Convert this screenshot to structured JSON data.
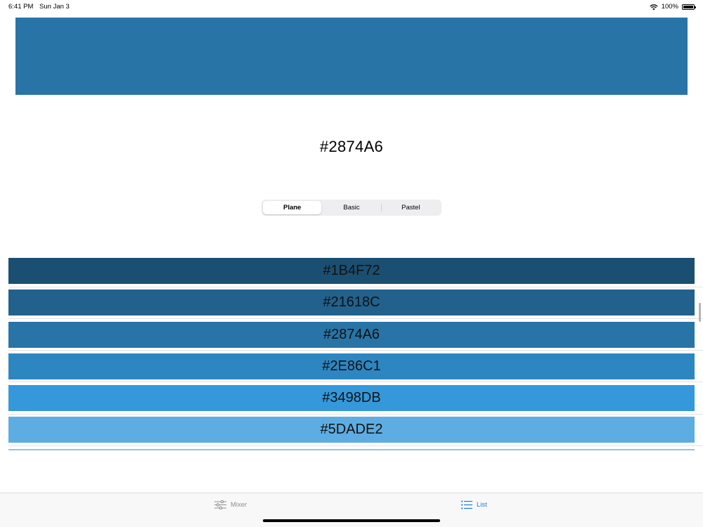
{
  "status_bar": {
    "time": "6:41 PM",
    "date": "Sun Jan 3",
    "battery": "100%",
    "icons": [
      "wifi-icon",
      "battery-icon"
    ]
  },
  "preview": {
    "color": "#2874A6",
    "hex_label": "#2874A6"
  },
  "segmented": {
    "options": [
      "Plane",
      "Basic",
      "Pastel"
    ],
    "selected": "Plane"
  },
  "colors": [
    {
      "hex": "#1B4F72"
    },
    {
      "hex": "#21618C"
    },
    {
      "hex": "#2874A6"
    },
    {
      "hex": "#2E86C1"
    },
    {
      "hex": "#3498DB"
    },
    {
      "hex": "#5DADE2"
    }
  ],
  "tab_bar": {
    "tabs": [
      {
        "label": "Mixer",
        "icon": "sliders-icon",
        "selected": false
      },
      {
        "label": "List",
        "icon": "list-icon",
        "selected": true
      }
    ],
    "accent": "#1A7FD6"
  }
}
